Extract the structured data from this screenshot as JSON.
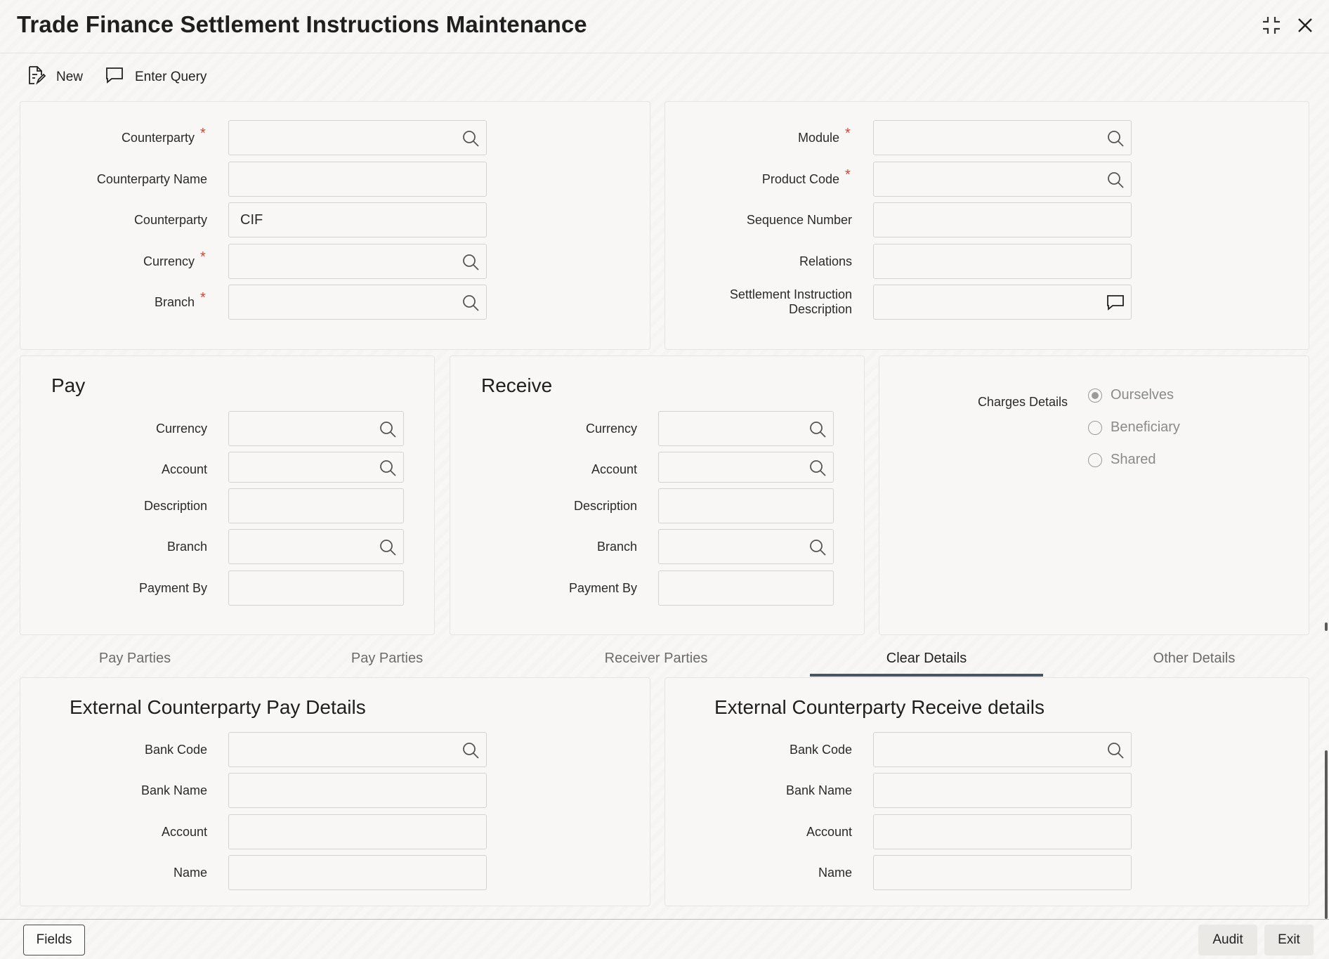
{
  "window": {
    "title": "Trade Finance Settlement Instructions Maintenance"
  },
  "toolbar": {
    "new_label": "New",
    "enter_query_label": "Enter Query"
  },
  "header_left": {
    "counterparty": {
      "label": "Counterparty",
      "value": ""
    },
    "counterparty_name": {
      "label": "Counterparty Name",
      "value": ""
    },
    "counterparty_type": {
      "label": "Counterparty",
      "value": "CIF"
    },
    "currency": {
      "label": "Currency",
      "value": ""
    },
    "branch": {
      "label": "Branch",
      "value": ""
    },
    "required_mark": "*"
  },
  "header_right": {
    "module": {
      "label": "Module",
      "value": ""
    },
    "product_code": {
      "label": "Product Code",
      "value": ""
    },
    "sequence_number": {
      "label": "Sequence Number",
      "value": ""
    },
    "relations": {
      "label": "Relations",
      "value": ""
    },
    "settlement_desc": {
      "label_line1": "Settlement Instruction",
      "label_line2": "Description",
      "value": ""
    }
  },
  "pay": {
    "title": "Pay",
    "currency": {
      "label": "Currency",
      "value": ""
    },
    "account": {
      "label": "Account",
      "value": ""
    },
    "description": {
      "label": "Description",
      "value": ""
    },
    "branch": {
      "label": "Branch",
      "value": ""
    },
    "payment_by": {
      "label": "Payment By",
      "value": ""
    }
  },
  "receive": {
    "title": "Receive",
    "currency": {
      "label": "Currency",
      "value": ""
    },
    "account": {
      "label": "Account",
      "value": ""
    },
    "description": {
      "label": "Description",
      "value": ""
    },
    "branch": {
      "label": "Branch",
      "value": ""
    },
    "payment_by": {
      "label": "Payment By",
      "value": ""
    }
  },
  "charges": {
    "label": "Charges Details",
    "options": [
      "Ourselves",
      "Beneficiary",
      "Shared"
    ],
    "selected": "Ourselves"
  },
  "tabs": {
    "items": [
      "Pay Parties",
      "Pay Parties",
      "Receiver Parties",
      "Clear Details",
      "Other Details"
    ],
    "active": "Clear Details"
  },
  "ext_pay": {
    "title": "External Counterparty Pay Details",
    "bank_code": {
      "label": "Bank Code",
      "value": ""
    },
    "bank_name": {
      "label": "Bank Name",
      "value": ""
    },
    "account": {
      "label": "Account",
      "value": ""
    },
    "name": {
      "label": "Name",
      "value": ""
    }
  },
  "ext_receive": {
    "title": "External Counterparty Receive details",
    "bank_code": {
      "label": "Bank Code",
      "value": ""
    },
    "bank_name": {
      "label": "Bank Name",
      "value": ""
    },
    "account": {
      "label": "Account",
      "value": ""
    },
    "name": {
      "label": "Name",
      "value": ""
    }
  },
  "footer": {
    "fields_label": "Fields",
    "audit_label": "Audit",
    "exit_label": "Exit"
  },
  "icons": {
    "lookup": "search-icon",
    "description_popup": "speech-bubble-icon",
    "minimize": "collapse-icon",
    "close": "close-icon"
  },
  "colors": {
    "required": "#c7463a",
    "active_tab_underline": "#4a5563"
  }
}
